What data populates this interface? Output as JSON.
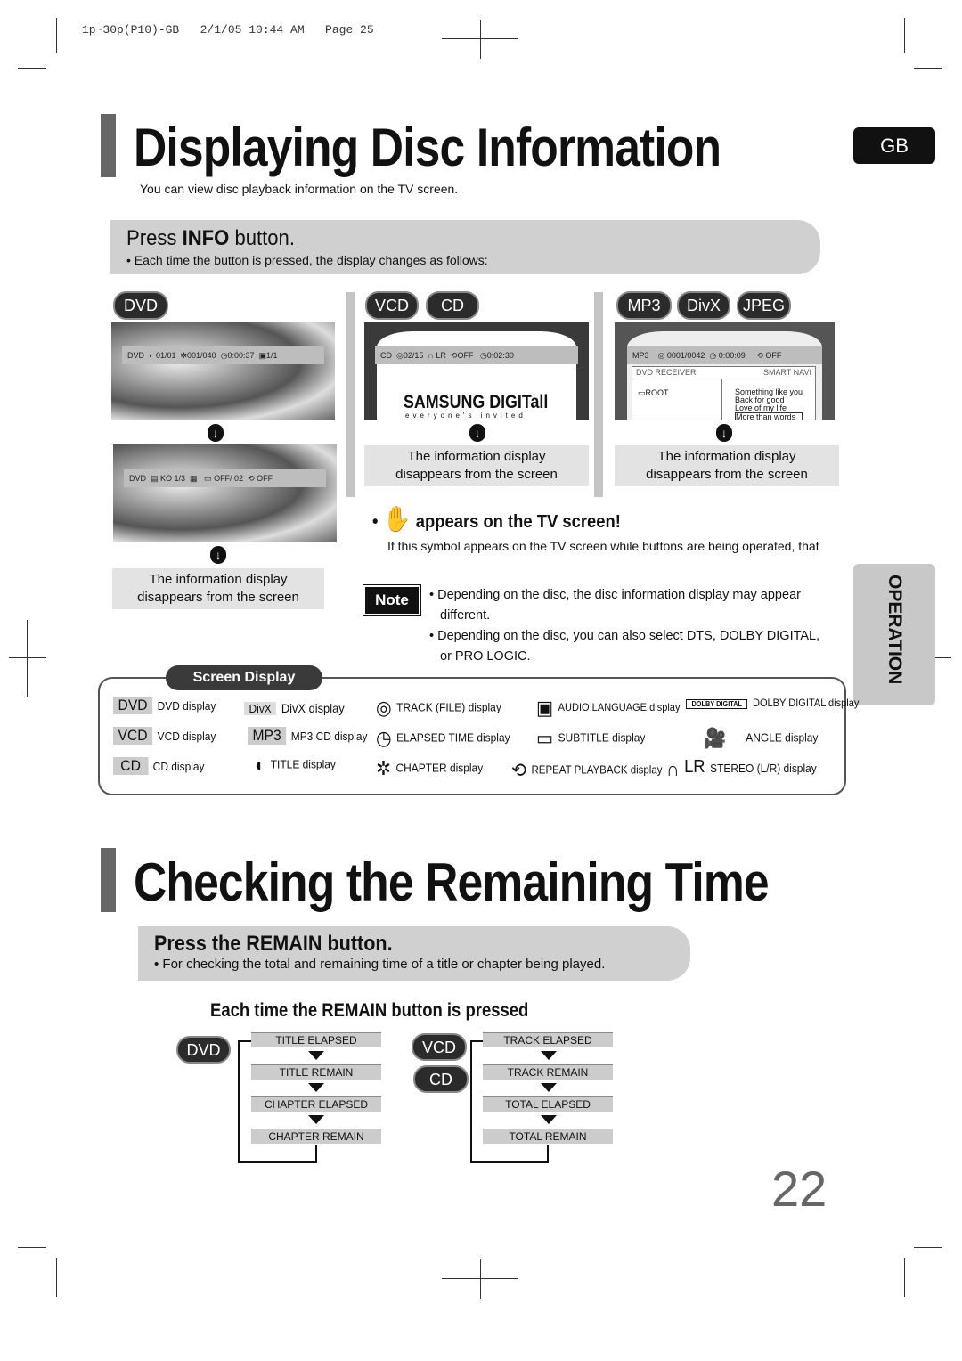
{
  "print_header": "1p~30p(P10)-GB   2/1/05 10:44 AM   Page 25",
  "section1": {
    "title": "Displaying Disc Information",
    "subtitle": "You can view disc playback information  on the TV screen.",
    "badge": "GB",
    "press": {
      "prefix": "Press ",
      "bold": "INFO",
      "suffix": " button.",
      "bullet": "Each time the button is pressed, the display changes as follows:"
    }
  },
  "columns": {
    "dvd": {
      "pill": "DVD",
      "osd1": [
        "DVD",
        "01/01",
        "001/040",
        "0:00:37",
        "1/1"
      ],
      "osd2": [
        "DVD",
        "KO 1/3",
        "OFF/ 02",
        "OFF"
      ],
      "info": [
        "The information display",
        "disappears from the screen"
      ]
    },
    "vcd": {
      "pills": [
        "VCD",
        "CD"
      ],
      "osd": [
        "CD",
        "02/15",
        "LR",
        "OFF",
        "0:02:30"
      ],
      "logo": "SAMSUNG DIGITall",
      "logo_tag": "everyone's invited",
      "info": [
        "The information display",
        "disappears from the screen"
      ]
    },
    "mp3": {
      "pills": [
        "MP3",
        "DivX",
        "JPEG"
      ],
      "osd": [
        "MP3",
        "0001/0042",
        "0:00:09",
        "OFF"
      ],
      "nav_left": "DVD RECEIVER",
      "nav_right": "SMART NAVI",
      "root": "ROOT",
      "files": [
        "Something like you",
        "Back for good",
        "Love of my life",
        "More than words"
      ],
      "info": [
        "The information display",
        "disappears from the screen"
      ]
    }
  },
  "hand": {
    "heading": "appears on the TV screen!",
    "text": "If this symbol appears on the TV screen while buttons are being operated, that"
  },
  "note": {
    "label": "Note",
    "bullets": [
      "Depending on the disc, the disc information display may appear different.",
      "Depending on the disc, you can also select DTS, DOLBY DIGITAL, or PRO LOGIC."
    ]
  },
  "screen_display": {
    "label": "Screen Display",
    "items": [
      {
        "tag": "DVD",
        "text": "DVD display"
      },
      {
        "tag": "VCD",
        "text": "VCD display"
      },
      {
        "tag": "CD",
        "text": "CD display"
      },
      {
        "tag": "DivX",
        "text": "DivX display"
      },
      {
        "tag": "MP3",
        "text": "MP3 CD display"
      },
      {
        "icon": "title-icon",
        "text": "TITLE display"
      },
      {
        "icon": "track-icon",
        "text": "TRACK (FILE) display"
      },
      {
        "icon": "clock-icon",
        "text": "ELAPSED TIME display"
      },
      {
        "icon": "chapter-icon",
        "text": "CHAPTER display"
      },
      {
        "icon": "audio-language-icon",
        "text": "AUDIO LANGUAGE display"
      },
      {
        "icon": "subtitle-icon",
        "text": "SUBTITLE display"
      },
      {
        "icon": "repeat-icon",
        "text": "REPEAT PLAYBACK display"
      },
      {
        "tag": "DOLBY DIGITAL",
        "text": "DOLBY DIGITAL display"
      },
      {
        "icon": "angle-icon",
        "text": "ANGLE display"
      },
      {
        "tag": "LR",
        "text": "STEREO (L/R) display"
      }
    ]
  },
  "side_tab": "OPERATION",
  "section2": {
    "title": "Checking the Remaining Time",
    "press": "Press the REMAIN button.",
    "bullet": "For checking the total and remaining time of a title or chapter being played.",
    "subheading": "Each time the REMAIN button is pressed",
    "dvd": {
      "pill": "DVD",
      "steps": [
        "TITLE ELAPSED",
        "TITLE REMAIN",
        "CHAPTER ELAPSED",
        "CHAPTER REMAIN"
      ]
    },
    "vcd": {
      "pills": [
        "VCD",
        "CD"
      ],
      "steps": [
        "TRACK ELAPSED",
        "TRACK REMAIN",
        "TOTAL ELAPSED",
        "TOTAL REMAIN"
      ]
    }
  },
  "page_number": "22"
}
